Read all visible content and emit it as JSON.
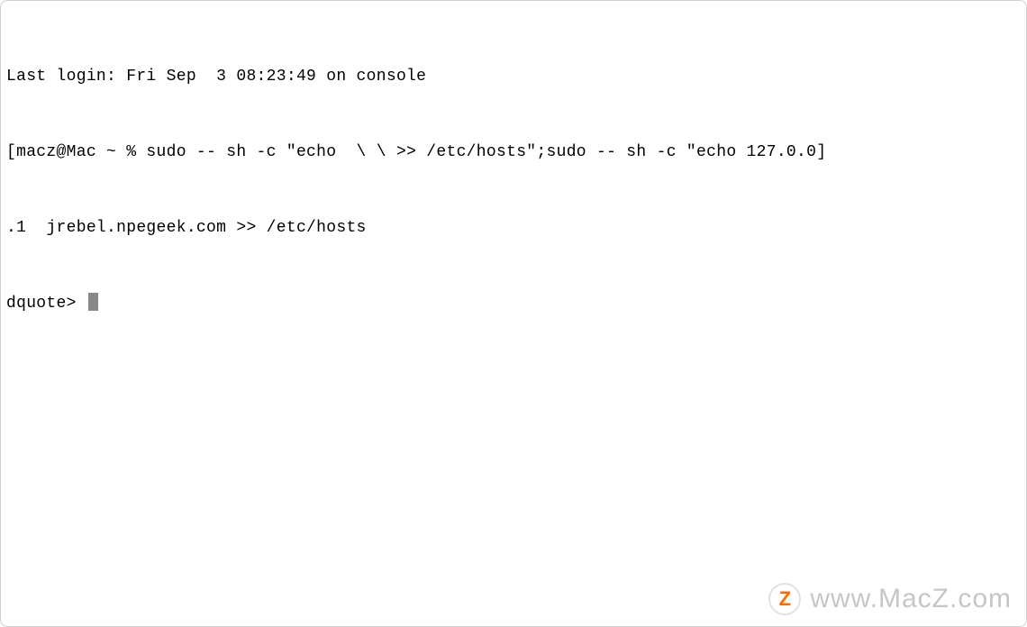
{
  "terminal": {
    "lines": {
      "last_login": "Last login: Fri Sep  3 08:23:49 on console",
      "cmd1": "[macz@Mac ~ % sudo -- sh -c \"echo  \\ \\ >> /etc/hosts\";sudo -- sh -c \"echo 127.0.0]",
      "cmd2": ".1  jrebel.npegeek.com >> /etc/hosts",
      "prompt": "dquote> "
    }
  },
  "watermark": {
    "logo_letter": "Z",
    "text": "www.MacZ.com"
  }
}
